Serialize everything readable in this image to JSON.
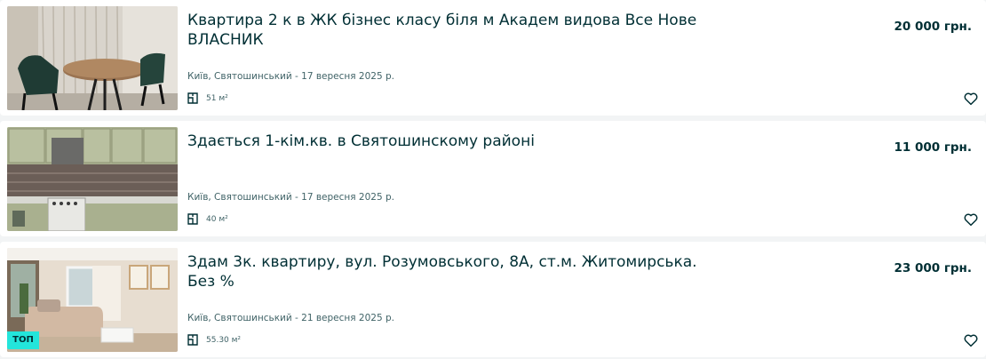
{
  "listings": [
    {
      "title": "Квартира 2 к в ЖК бізнес класу біля м Академ видова Все Нове ВЛАСНИК",
      "price": "20 000 грн.",
      "location_date": "Київ, Святошинський - 17 вересня 2025 р.",
      "area": "51 м²",
      "image_icon": "dining-room-photo",
      "favorite_icon": "heart-icon"
    },
    {
      "title": "Здається 1-кім.кв. в Святошинскому районі",
      "price": "11 000 грн.",
      "location_date": "Київ, Святошинський - 17 вересня 2025 р.",
      "area": "40 м²",
      "image_icon": "kitchen-photo",
      "favorite_icon": "heart-icon"
    },
    {
      "title": "Здам 3к. квартиру, вул. Розумовського, 8А, ст.м. Житомирська. Без %",
      "price": "23 000 грн.",
      "location_date": "Київ, Святошинський - 21 вересня 2025 р.",
      "area": "55.30 м²",
      "image_icon": "living-room-photo",
      "favorite_icon": "heart-icon",
      "badge": "ТОП"
    }
  ],
  "colors": {
    "text": "#002f34",
    "muted": "#406367",
    "badge": "#23e5db",
    "background": "#f2f4f5"
  }
}
